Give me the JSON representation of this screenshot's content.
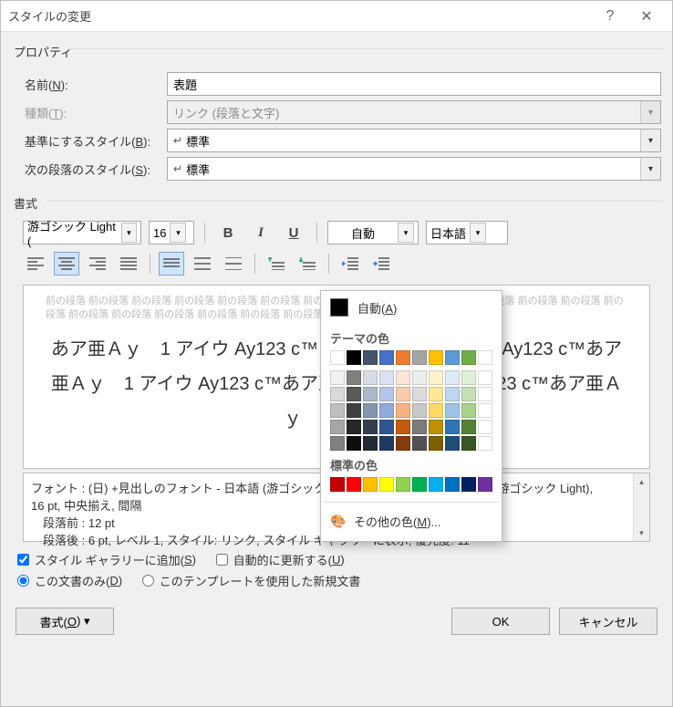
{
  "title": "スタイルの変更",
  "properties_label": "プロパティ",
  "format_label": "書式",
  "fields": {
    "name_label": "名前(N):",
    "name_value": "表題",
    "type_label": "種類(T):",
    "type_value": "リンク (段落と文字)",
    "based_label": "基準にするスタイル(B):",
    "based_value": "標準",
    "next_label": "次の段落のスタイル(S):",
    "next_value": "標準"
  },
  "font": {
    "name": "游ゴシック Light (",
    "size": "16",
    "bold": "B",
    "italic": "I",
    "underline": "U",
    "color_label": "自動",
    "lang": "日本語"
  },
  "color_popup": {
    "auto_label": "自動(A)",
    "theme_label": "テーマの色",
    "theme_base": [
      "#ffffff",
      "#000000",
      "#44546a",
      "#4472c4",
      "#ed7d31",
      "#a5a5a5",
      "#ffc000",
      "#5b9bd5",
      "#70ad47",
      "#ffffff"
    ],
    "theme_shades": [
      [
        "#f2f2f2",
        "#d9d9d9",
        "#bfbfbf",
        "#a6a6a6",
        "#808080"
      ],
      [
        "#808080",
        "#595959",
        "#404040",
        "#262626",
        "#0d0d0d"
      ],
      [
        "#d6dce5",
        "#adb9ca",
        "#8497b0",
        "#333f50",
        "#222a35"
      ],
      [
        "#d9e2f3",
        "#b4c6e7",
        "#8faadc",
        "#2f5597",
        "#1f3864"
      ],
      [
        "#fbe5d6",
        "#f8cbad",
        "#f4b183",
        "#c55a11",
        "#843c0c"
      ],
      [
        "#ededed",
        "#dbdbdb",
        "#c9c9c9",
        "#7b7b7b",
        "#525252"
      ],
      [
        "#fff2cc",
        "#ffe699",
        "#ffd966",
        "#bf9000",
        "#7f6000"
      ],
      [
        "#deebf7",
        "#bdd7ee",
        "#9dc3e6",
        "#2e75b6",
        "#1f4e79"
      ],
      [
        "#e2f0d9",
        "#c5e0b4",
        "#a9d18e",
        "#538135",
        "#385723"
      ],
      [
        "#ffffff",
        "#ffffff",
        "#ffffff",
        "#ffffff",
        "#ffffff"
      ]
    ],
    "standard_label": "標準の色",
    "standard": [
      "#c00000",
      "#ff0000",
      "#ffc000",
      "#ffff00",
      "#92d050",
      "#00b050",
      "#00b0f0",
      "#0070c0",
      "#002060",
      "#7030a0"
    ],
    "more_label": "その他の色(M)..."
  },
  "preview": {
    "ghost": "前の段落 前の段落 前の段落 前の段落 前の段落 前の段落 前の段落 前の段落 前の段落 前の段落 前の段落 前の段落 前の段落 前の段落 前の段落 前の段落 前の段落 前の段落 前の段落 前の段落 前の段落",
    "sample": "あア亜Ａｙ　1 アイウ Ay123 c™あア亜Ａｙ　1 アイウ Ay123 c™あア亜Ａｙ　1 アイウ Ay123 c™あア亜Ａｙ　1 アイウ Ay123 c™あア亜Ａｙ　1 アイウ"
  },
  "description": {
    "line1": "フォント : (日) +見出しのフォント - 日本語 (游ゴシック Light), (英) +見出しのフォント (游ゴシック Light),",
    "line2": "16 pt, 中央揃え, 間隔",
    "line3": "　段落前 :  12 pt",
    "line4": "　段落後 :  6 pt, レベル 1, スタイル: リンク, スタイル ギャラリーに表示, 優先度: 11"
  },
  "checks": {
    "gallery": "スタイル ギャラリーに追加(S)",
    "auto": "自動的に更新する(U)",
    "doc_only": "この文書のみ(D)",
    "template": "このテンプレートを使用した新規文書"
  },
  "buttons": {
    "format": "書式(O)",
    "ok": "OK",
    "cancel": "キャンセル"
  }
}
